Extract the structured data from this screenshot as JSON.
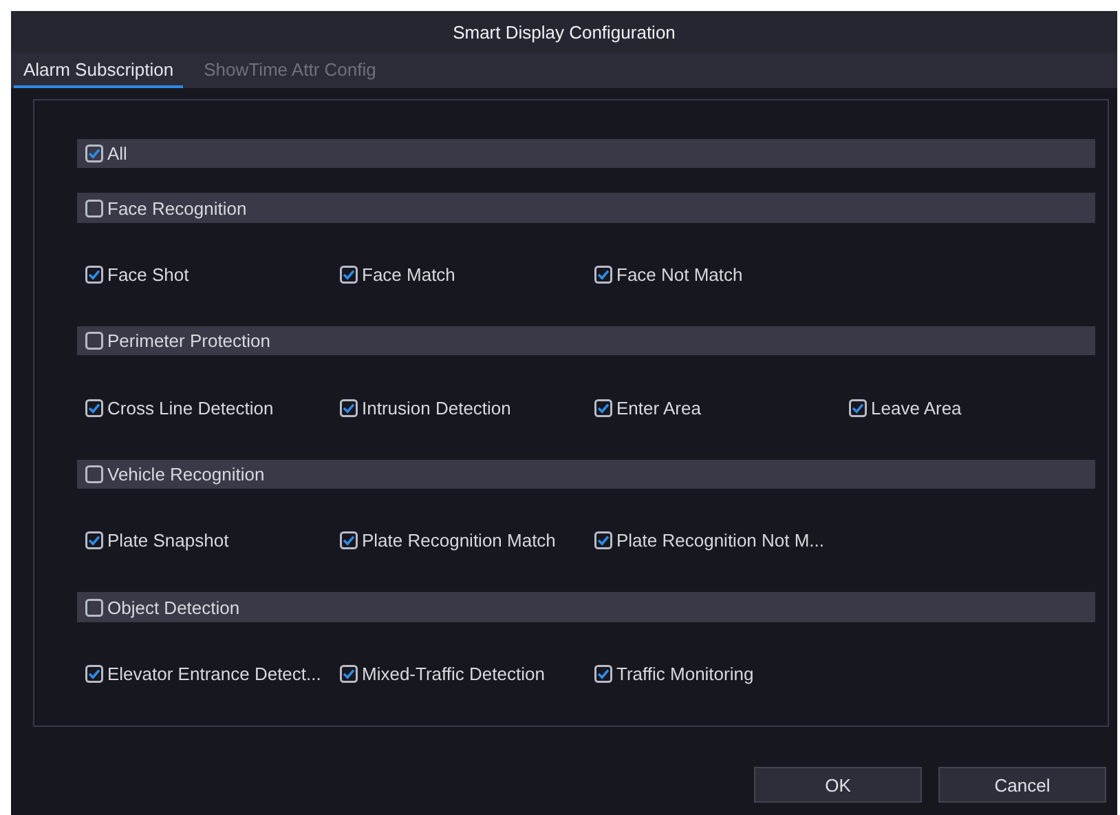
{
  "window": {
    "title": "Smart Display Configuration"
  },
  "tabs": [
    {
      "label": "Alarm Subscription",
      "selected": true
    },
    {
      "label": "ShowTime Attr Config",
      "selected": false
    }
  ],
  "all": {
    "label": "All",
    "checked": true
  },
  "groups": [
    {
      "label": "Face Recognition",
      "checked": false,
      "items": [
        {
          "label": "Face Shot",
          "checked": true
        },
        {
          "label": "Face Match",
          "checked": true
        },
        {
          "label": "Face Not Match",
          "checked": true
        }
      ]
    },
    {
      "label": "Perimeter Protection",
      "checked": false,
      "items": [
        {
          "label": "Cross Line Detection",
          "checked": true
        },
        {
          "label": "Intrusion Detection",
          "checked": true
        },
        {
          "label": "Enter Area",
          "checked": true
        },
        {
          "label": "Leave Area",
          "checked": true
        }
      ]
    },
    {
      "label": "Vehicle Recognition",
      "checked": false,
      "items": [
        {
          "label": "Plate Snapshot",
          "checked": true
        },
        {
          "label": "Plate Recognition Match",
          "checked": true
        },
        {
          "label": "Plate Recognition Not M...",
          "checked": true
        }
      ]
    },
    {
      "label": "Object Detection",
      "checked": false,
      "items": [
        {
          "label": "Elevator Entrance Detect...",
          "checked": true
        },
        {
          "label": "Mixed-Traffic Detection",
          "checked": true
        },
        {
          "label": "Traffic Monitoring",
          "checked": true
        }
      ]
    }
  ],
  "buttons": [
    {
      "label": "OK"
    },
    {
      "label": "Cancel"
    }
  ]
}
